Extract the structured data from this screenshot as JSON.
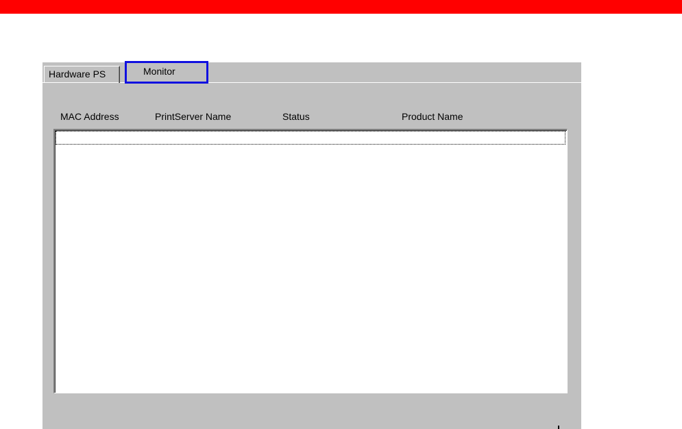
{
  "tabs": [
    {
      "label": "Hardware PS",
      "selected": false
    },
    {
      "label": "Monitor",
      "selected": true,
      "highlight_color": "#1010e0"
    }
  ],
  "list": {
    "columns": [
      "MAC Address",
      "PrintServer Name",
      "Status",
      "Product Name"
    ],
    "rows": []
  },
  "colors": {
    "banner": "#ff0000",
    "dialog_bg": "#c0c0c0"
  }
}
